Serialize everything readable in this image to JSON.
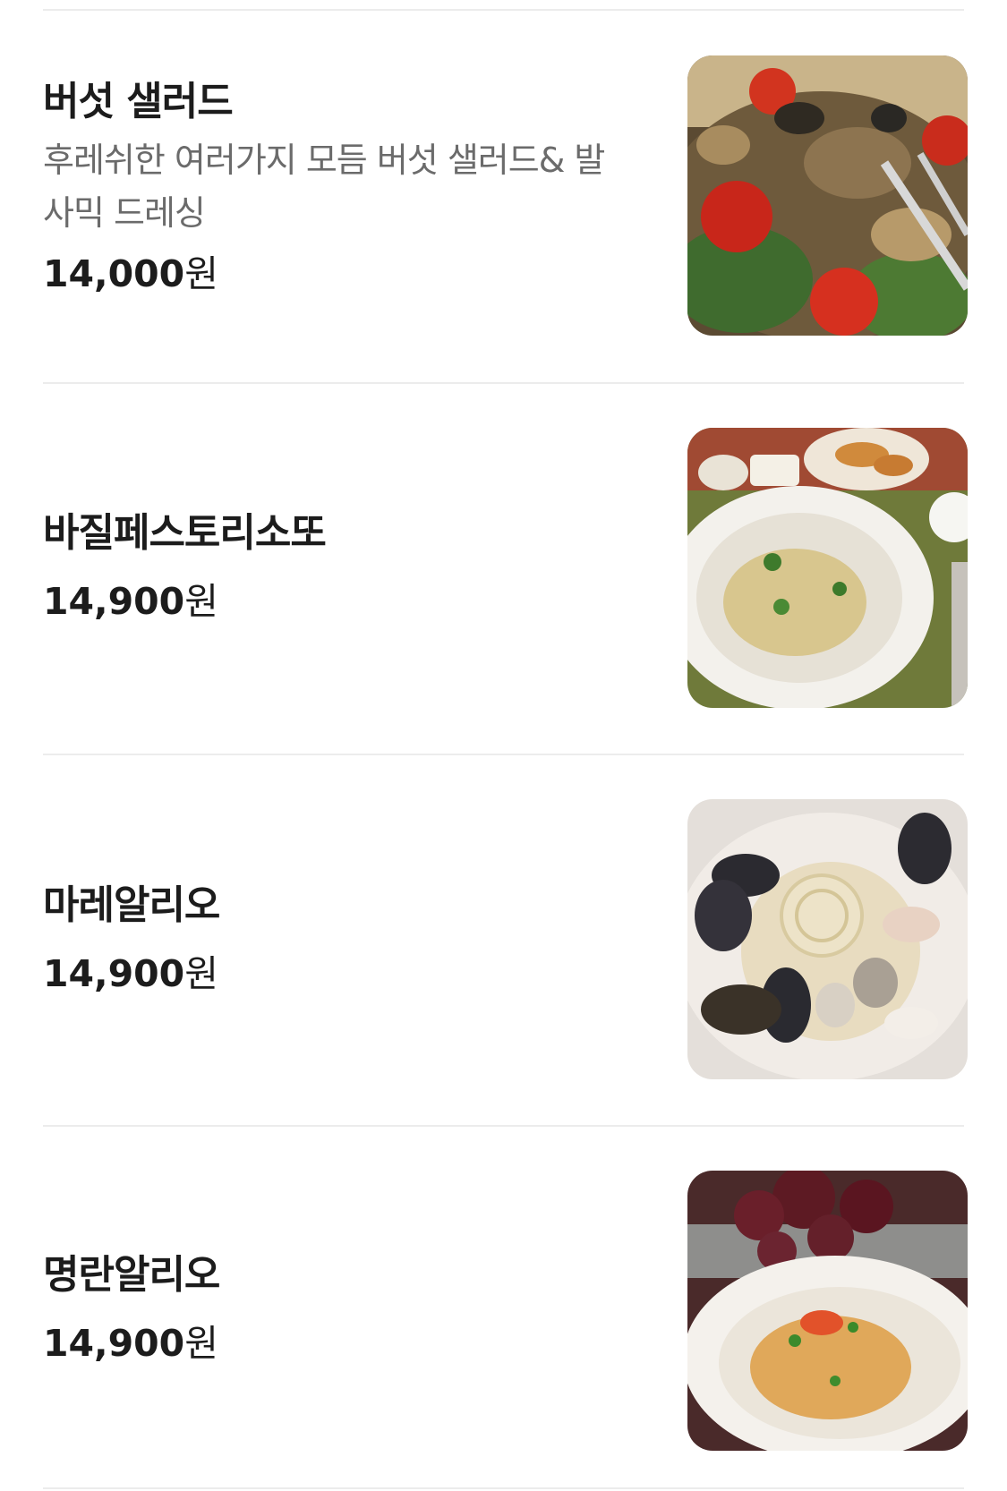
{
  "menu": {
    "items": [
      {
        "name": "버섯 샐러드",
        "description": "후레쉬한 여러가지 모듬 버섯 샐러드& 발사믹 드레싱",
        "price": "14,000",
        "currency": "원",
        "image": "mushroom-salad-photo"
      },
      {
        "name": "바질페스토리소또",
        "price": "14,900",
        "currency": "원",
        "image": "basil-pesto-risotto-photo"
      },
      {
        "name": "마레알리오",
        "price": "14,900",
        "currency": "원",
        "image": "mare-aglio-pasta-photo"
      },
      {
        "name": "명란알리오",
        "price": "14,900",
        "currency": "원",
        "image": "pollock-roe-aglio-pasta-photo"
      }
    ]
  }
}
